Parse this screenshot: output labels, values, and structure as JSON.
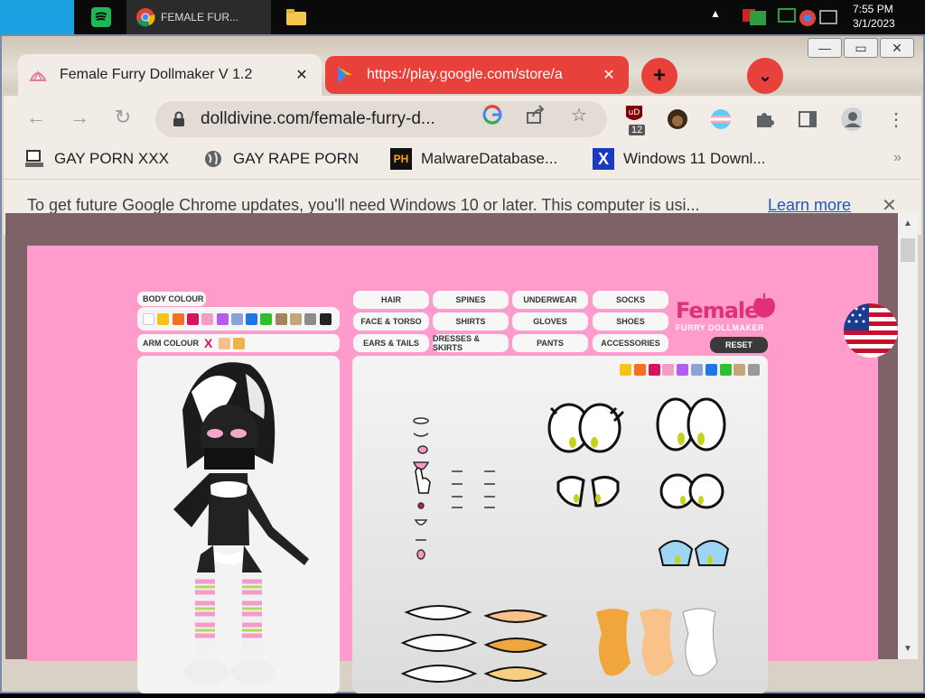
{
  "taskbar": {
    "chrome_title": "FEMALE FUR...",
    "clock_time": "7:55 PM",
    "clock_date": "3/1/2023"
  },
  "browser": {
    "tabs": [
      {
        "title": "Female Furry Dollmaker V 1.2",
        "close": "✕"
      },
      {
        "title": "https://play.google.com/store/a",
        "close": "✕"
      }
    ],
    "new_tab": "+",
    "tab_list": "⌄",
    "url": "dolldivine.com/female-furry-d...",
    "ext_badge": "12",
    "window_controls": [
      "—",
      "▭",
      "✕"
    ]
  },
  "bookmarks": [
    {
      "label": "GAY PORN XXX",
      "icon": "computer-icon"
    },
    {
      "label": "GAY RAPE PORN",
      "icon": "globe-icon"
    },
    {
      "label": "MalwareDatabase...",
      "icon": "ph-icon",
      "icon_text": "PH"
    },
    {
      "label": "Windows 11 Downl...",
      "icon": "x-icon",
      "icon_text": "X"
    }
  ],
  "bookmarks_more": "»",
  "infobar": {
    "message": "To get future Google Chrome updates, you'll need Windows 10 or later. This computer is usi...",
    "link": "Learn more",
    "close": "✕"
  },
  "game": {
    "body_colour_label": "BODY COLOUR",
    "arm_colour_label": "ARM COLOUR",
    "arm_x": "X",
    "body_colours": [
      "#ffffff",
      "#f7c21c",
      "#f37022",
      "#d6145e",
      "#f49cc7",
      "#b45bf1",
      "#8aa4d4",
      "#1f77e6",
      "#2fbf2f",
      "#a5835c",
      "#c5a57a",
      "#8c8c8c",
      "#222222"
    ],
    "arm_colours": [
      "#f5c08a",
      "#f0b34c"
    ],
    "palette_right": [
      "#f7c21c",
      "#f37022",
      "#d6145e",
      "#f49cc7",
      "#b45bf1",
      "#8aa4d4",
      "#1f77e6",
      "#2fbf2f",
      "#c5a57a",
      "#9a9a9a"
    ],
    "categories": [
      [
        "HAIR",
        "SPINES",
        "UNDERWEAR",
        "SOCKS"
      ],
      [
        "FACE & TORSO",
        "SHIRTS",
        "GLOVES",
        "SHOES"
      ],
      [
        "EARS & TAILS",
        "DRESSES & SKIRTS",
        "PANTS",
        "ACCESSORIES"
      ]
    ],
    "reset": "RESET",
    "logo_main": "Female",
    "logo_sub": "FURRY DOLLMAKER"
  }
}
